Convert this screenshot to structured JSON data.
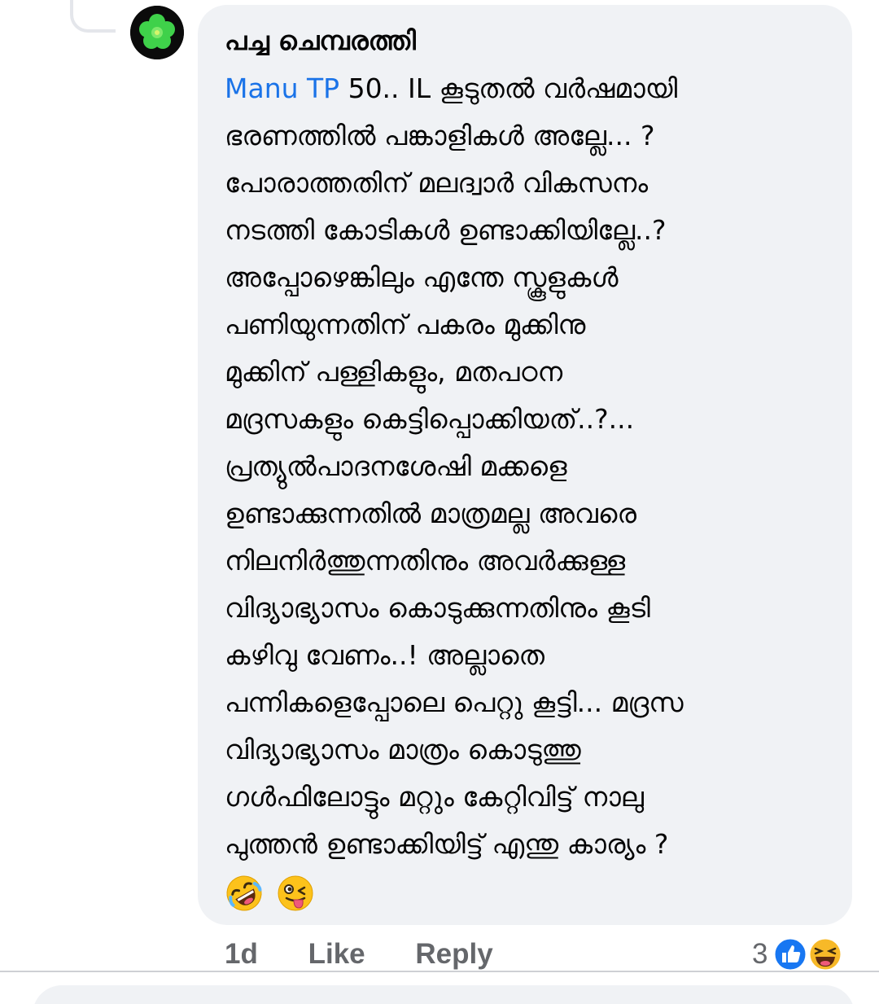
{
  "comment": {
    "author": "പച്ച ചെമ്പരത്തി",
    "mention": "Manu TP",
    "lines": [
      " 50.. IL കൂടുതൽ വർഷമായി",
      "ഭരണത്തിൽ പങ്കാളികൾ അല്ലേ... ?",
      "പോരാത്തതിന് മലദ്വാർ വികസനം",
      "നടത്തി കോടികൾ ഉണ്ടാക്കിയില്ലേ..?",
      "അപ്പോഴെങ്കിലും എന്തേ സ്കൂളുകൾ",
      "പണിയുന്നതിന് പകരം മുക്കിനു",
      "മുക്കിന് പള്ളികളും, മതപഠന",
      "മദ്രസകളും  കെട്ടിപ്പൊക്കിയത്..?...",
      "പ്രത്യുൽപാദനശേഷി മക്കളെ",
      "ഉണ്ടാക്കുന്നതിൽ മാത്രമല്ല അവരെ",
      "നിലനിർത്തുന്നതിനും അവർക്കുള്ള",
      "വിദ്യാഭ്യാസം കൊടുക്കുന്നതിനും കൂടി",
      "കഴിവു വേണം..! അല്ലാതെ",
      "പന്നികളെപ്പോലെ പെറ്റു കൂട്ടി... മദ്രസ",
      "വിദ്യാഭ്യാസം മാത്രം കൊടുത്തു",
      "ഗൾഫിലോട്ടും മറ്റും കേറ്റിവിട്ട് നാലു",
      "പുത്തൻ ഉണ്ടാക്കിയിട്ട് എന്തു കാര്യം ?"
    ],
    "emojis": [
      "rolling-on-floor-laughing-emoji",
      "winking-tongue-emoji"
    ],
    "time": "1d",
    "like_label": "Like",
    "reply_label": "Reply",
    "reaction_count": "3",
    "reactions": [
      "like-reaction-icon",
      "haha-reaction-icon"
    ]
  },
  "colors": {
    "bubble": "#f0f2f5",
    "mention": "#1a73e8",
    "text": "#050505",
    "meta": "#65676b",
    "like_blue": "#1877f2",
    "haha_yellow": "#f7b928"
  }
}
